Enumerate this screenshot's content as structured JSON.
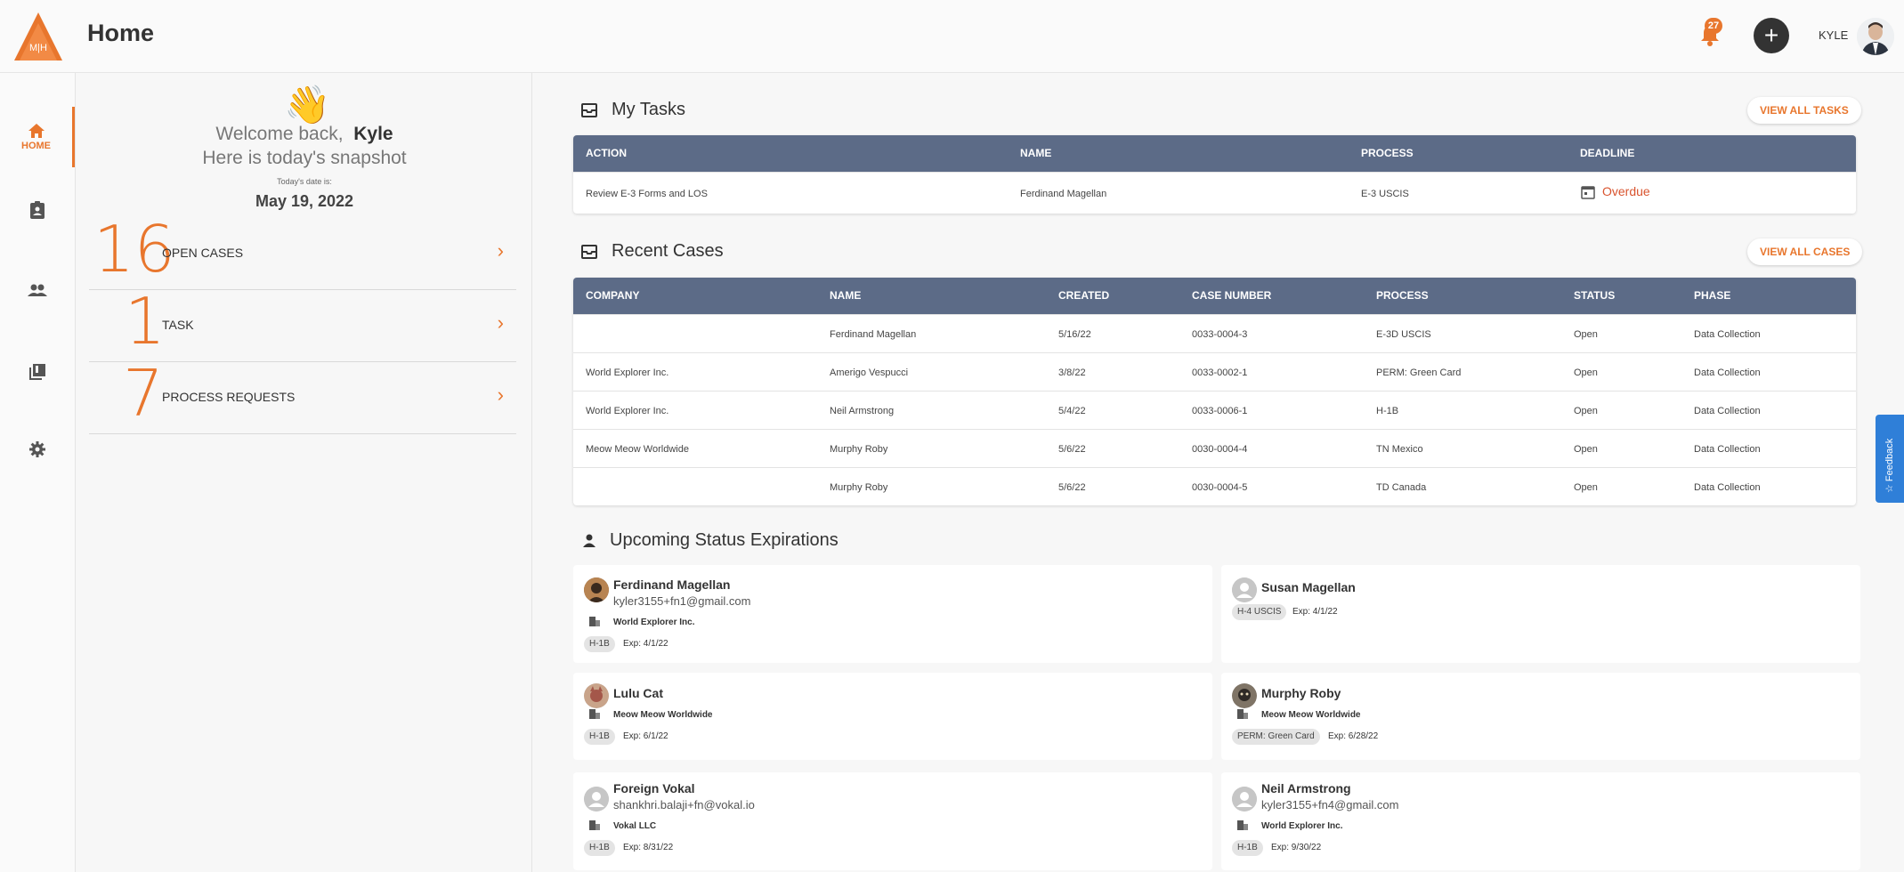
{
  "header": {
    "page_title": "Home",
    "logo_text": "M|H",
    "notification_count": "27",
    "add_label": "+",
    "user_name": "KYLE"
  },
  "nav": {
    "items": [
      {
        "label": "HOME",
        "icon": "home-icon",
        "active": true
      },
      {
        "label": "",
        "icon": "cases-clipboard-icon"
      },
      {
        "label": "",
        "icon": "people-icon"
      },
      {
        "label": "",
        "icon": "library-icon"
      },
      {
        "label": "",
        "icon": "settings-gear-icon"
      }
    ]
  },
  "summary": {
    "greeting": "Welcome back,",
    "user": "Kyle",
    "snapshot": "Here is today's snapshot",
    "date_label": "Today's date is:",
    "date_value": "May 19, 2022",
    "stats": [
      {
        "number": "16",
        "label": "OPEN CASES"
      },
      {
        "number": "1",
        "label": "TASK"
      },
      {
        "number": "7",
        "label": "PROCESS REQUESTS"
      }
    ]
  },
  "tasks": {
    "title": "My Tasks",
    "view_all": "VIEW ALL TASKS",
    "columns": [
      "ACTION",
      "NAME",
      "PROCESS",
      "DEADLINE"
    ],
    "rows": [
      {
        "action": "Review E-3 Forms and LOS",
        "name": "Ferdinand Magellan",
        "process": "E-3 USCIS",
        "deadline": "Overdue"
      }
    ]
  },
  "cases": {
    "title": "Recent Cases",
    "view_all": "VIEW ALL CASES",
    "columns": [
      "COMPANY",
      "NAME",
      "CREATED",
      "CASE NUMBER",
      "PROCESS",
      "STATUS",
      "PHASE"
    ],
    "rows": [
      {
        "company": "",
        "name": "Ferdinand Magellan",
        "created": "5/16/22",
        "case_number": "0033-0004-3",
        "process": "E-3D USCIS",
        "status": "Open",
        "phase": "Data Collection"
      },
      {
        "company": "World Explorer Inc.",
        "name": "Amerigo Vespucci",
        "created": "3/8/22",
        "case_number": "0033-0002-1",
        "process": "PERM: Green Card",
        "status": "Open",
        "phase": "Data Collection"
      },
      {
        "company": "World Explorer Inc.",
        "name": "Neil Armstrong",
        "created": "5/4/22",
        "case_number": "0033-0006-1",
        "process": "H-1B",
        "status": "Open",
        "phase": "Data Collection"
      },
      {
        "company": "Meow Meow Worldwide",
        "name": "Murphy Roby",
        "created": "5/6/22",
        "case_number": "0030-0004-4",
        "process": "TN Mexico",
        "status": "Open",
        "phase": "Data Collection"
      },
      {
        "company": "",
        "name": "Murphy Roby",
        "created": "5/6/22",
        "case_number": "0030-0004-5",
        "process": "TD Canada",
        "status": "Open",
        "phase": "Data Collection"
      }
    ]
  },
  "expirations": {
    "title": "Upcoming Status Expirations",
    "exp_prefix": "Exp:",
    "people": [
      {
        "name": "Ferdinand Magellan",
        "email": "kyler3155+fn1@gmail.com",
        "company": "World Explorer Inc.",
        "visa": "H-1B",
        "exp": "Exp:  4/1/22",
        "avatar": "photo"
      },
      {
        "name": "Susan Magellan",
        "email": "",
        "company": "",
        "visa": "H-4 USCIS",
        "exp": "Exp:  4/1/22",
        "avatar": "default"
      },
      {
        "name": "Lulu Cat",
        "email": "",
        "company": "Meow Meow Worldwide",
        "visa": "H-1B",
        "exp": "Exp:  6/1/22",
        "avatar": "photo"
      },
      {
        "name": "Murphy Roby",
        "email": "",
        "company": "Meow Meow Worldwide",
        "visa": "PERM: Green Card",
        "exp": "Exp:  6/28/22",
        "avatar": "photo"
      },
      {
        "name": "Foreign Vokal",
        "email": "shankhri.balaji+fn@vokal.io",
        "company": "Vokal LLC",
        "visa": "H-1B",
        "exp": "Exp:  8/31/22",
        "avatar": "default"
      },
      {
        "name": "Neil Armstrong",
        "email": "kyler3155+fn4@gmail.com",
        "company": "World Explorer Inc.",
        "visa": "H-1B",
        "exp": "Exp:  9/30/22",
        "avatar": "default"
      }
    ]
  },
  "feedback": {
    "label": "☆ Feedback"
  },
  "colors": {
    "accent": "#e8762d",
    "table_header": "#5c6b87",
    "overdue": "#d9542f",
    "feedback": "#2f7fd8"
  }
}
